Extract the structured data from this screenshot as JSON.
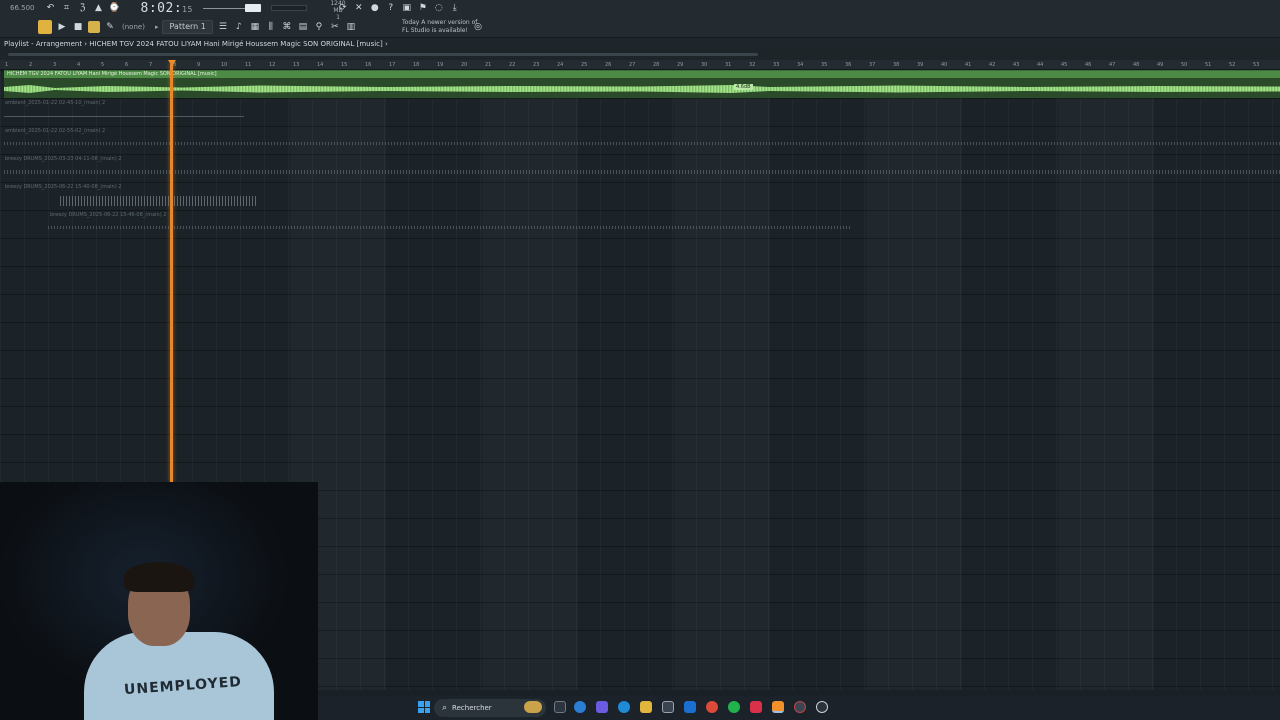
{
  "toolbar": {
    "cpu": "66.500",
    "time": "8:02",
    "time_sub": "15",
    "mem_value": "1240 MB",
    "mem_sub": "1",
    "snap": "(none)",
    "pattern": "Pattern 1",
    "news_line1": "Today  A newer version of",
    "news_line2": "FL Studio is available!"
  },
  "playlist": {
    "title": "Playlist - Arrangement › HICHEM TGV 2024  FATOU LIYAM  Hani Mirigé  Houssem Magic SON ORIGINAL [music] ›"
  },
  "ruler": {
    "ticks": [
      "1",
      "2",
      "3",
      "4",
      "5",
      "6",
      "7",
      "8",
      "9",
      "10",
      "11",
      "12",
      "13",
      "14",
      "15",
      "16",
      "17",
      "18",
      "19",
      "20",
      "21",
      "22",
      "23",
      "24",
      "25",
      "26",
      "27",
      "28",
      "29",
      "30",
      "31",
      "32",
      "33",
      "34",
      "35",
      "36",
      "37",
      "38",
      "39",
      "40",
      "41",
      "42",
      "43",
      "44",
      "45",
      "46",
      "47",
      "48",
      "49",
      "50",
      "51",
      "52",
      "53"
    ]
  },
  "tracks": {
    "main_clip": "HICHEM TGV 2024  FATOU LIYAM  Hani Mirigé  Houssem Magic SON ORIGINAL [music]",
    "main_level": "4.6dB",
    "clip1": "ambient_2025-01-22 02-45-10_(main) 2",
    "clip2": "ambient_2025-01-22 02-55-02_(main) 2",
    "clip3": "breezy DRUMS_2025-03-23 04-11-08_(main) 2",
    "clip4": "breezy DRUMS_2025-06-22 15-40-08_(main) 2",
    "clip5": "breezy DRUMS_2025-06-22 15-46-08_(main) 2"
  },
  "webcam": {
    "shirt_text": "UNEMPLOYED"
  },
  "taskbar": {
    "search_placeholder": "Rechercher"
  }
}
